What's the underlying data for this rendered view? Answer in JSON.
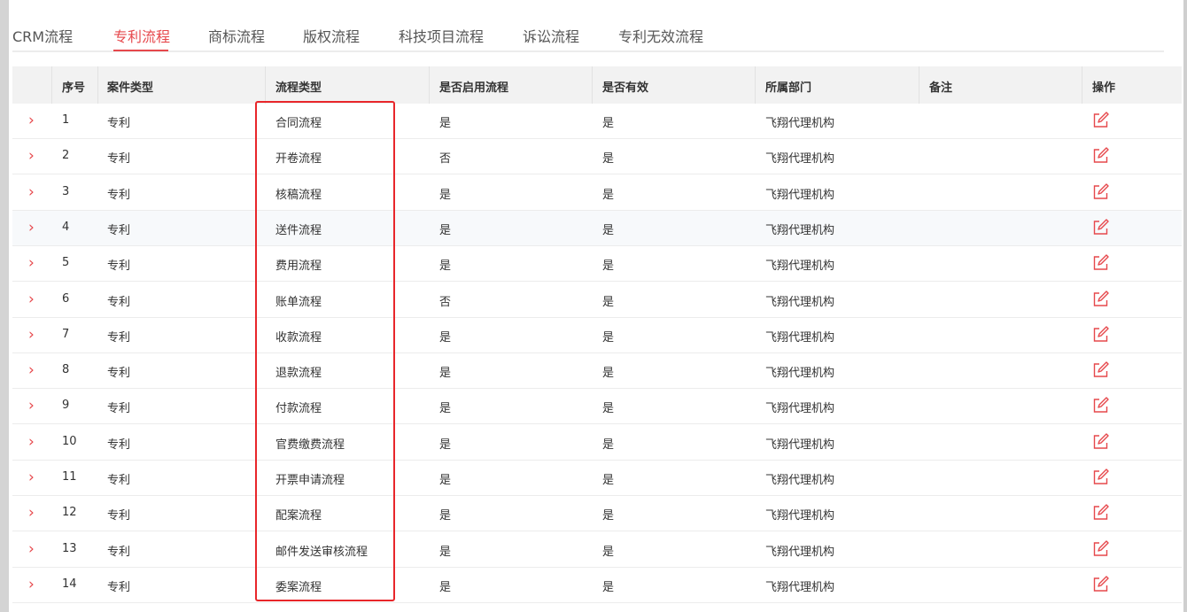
{
  "tabs": [
    {
      "label": "CRM流程",
      "active": false
    },
    {
      "label": "专利流程",
      "active": true
    },
    {
      "label": "商标流程",
      "active": false
    },
    {
      "label": "版权流程",
      "active": false
    },
    {
      "label": "科技项目流程",
      "active": false
    },
    {
      "label": "诉讼流程",
      "active": false
    },
    {
      "label": "专利无效流程",
      "active": false
    }
  ],
  "table": {
    "headers": {
      "index": "序号",
      "case_type": "案件类型",
      "flow_type": "流程类型",
      "enabled": "是否启用流程",
      "valid": "是否有效",
      "department": "所属部门",
      "remark": "备注",
      "action": "操作"
    },
    "rows": [
      {
        "index": "1",
        "case_type": "专利",
        "flow_type": "合同流程",
        "enabled": "是",
        "valid": "是",
        "department": "飞翔代理机构",
        "remark": ""
      },
      {
        "index": "2",
        "case_type": "专利",
        "flow_type": "开卷流程",
        "enabled": "否",
        "valid": "是",
        "department": "飞翔代理机构",
        "remark": ""
      },
      {
        "index": "3",
        "case_type": "专利",
        "flow_type": "核稿流程",
        "enabled": "是",
        "valid": "是",
        "department": "飞翔代理机构",
        "remark": ""
      },
      {
        "index": "4",
        "case_type": "专利",
        "flow_type": "送件流程",
        "enabled": "是",
        "valid": "是",
        "department": "飞翔代理机构",
        "remark": ""
      },
      {
        "index": "5",
        "case_type": "专利",
        "flow_type": "费用流程",
        "enabled": "是",
        "valid": "是",
        "department": "飞翔代理机构",
        "remark": ""
      },
      {
        "index": "6",
        "case_type": "专利",
        "flow_type": "账单流程",
        "enabled": "否",
        "valid": "是",
        "department": "飞翔代理机构",
        "remark": ""
      },
      {
        "index": "7",
        "case_type": "专利",
        "flow_type": "收款流程",
        "enabled": "是",
        "valid": "是",
        "department": "飞翔代理机构",
        "remark": ""
      },
      {
        "index": "8",
        "case_type": "专利",
        "flow_type": "退款流程",
        "enabled": "是",
        "valid": "是",
        "department": "飞翔代理机构",
        "remark": ""
      },
      {
        "index": "9",
        "case_type": "专利",
        "flow_type": "付款流程",
        "enabled": "是",
        "valid": "是",
        "department": "飞翔代理机构",
        "remark": ""
      },
      {
        "index": "10",
        "case_type": "专利",
        "flow_type": "官费缴费流程",
        "enabled": "是",
        "valid": "是",
        "department": "飞翔代理机构",
        "remark": ""
      },
      {
        "index": "11",
        "case_type": "专利",
        "flow_type": "开票申请流程",
        "enabled": "是",
        "valid": "是",
        "department": "飞翔代理机构",
        "remark": ""
      },
      {
        "index": "12",
        "case_type": "专利",
        "flow_type": "配案流程",
        "enabled": "是",
        "valid": "是",
        "department": "飞翔代理机构",
        "remark": ""
      },
      {
        "index": "13",
        "case_type": "专利",
        "flow_type": "邮件发送审核流程",
        "enabled": "是",
        "valid": "是",
        "department": "飞翔代理机构",
        "remark": ""
      },
      {
        "index": "14",
        "case_type": "专利",
        "flow_type": "委案流程",
        "enabled": "是",
        "valid": "是",
        "department": "飞翔代理机构",
        "remark": ""
      }
    ],
    "expand_icon": "chevron-right-icon",
    "action_icon": "edit-icon"
  },
  "colors": {
    "accent": "#e6484c",
    "highlight_border": "#e8262a",
    "header_bg": "#f2f2f2"
  }
}
